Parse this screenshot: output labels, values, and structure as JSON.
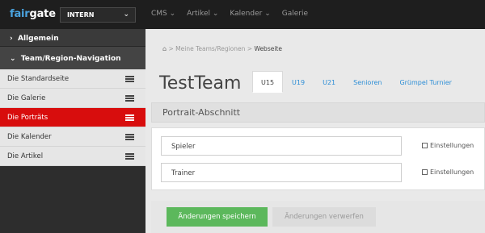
{
  "header": {
    "logo_part1": "fair",
    "logo_part2": "gate",
    "environment": "INTERN",
    "nav": [
      "CMS ⌄",
      "Artikel ⌄",
      "Kalender ⌄",
      "Galerie"
    ]
  },
  "sidebar": {
    "section1": "Allgemein",
    "section2": "Team/Region-Navigation",
    "items": [
      {
        "label": "Die Standardseite",
        "active": false
      },
      {
        "label": "Die Galerie",
        "active": false
      },
      {
        "label": "Die Porträts",
        "active": true
      },
      {
        "label": "Die Kalender",
        "active": false
      },
      {
        "label": "Die Artikel",
        "active": false
      }
    ]
  },
  "breadcrumb": {
    "home_icon": "home-icon",
    "middle": "Meine Teams/Regionen",
    "current": "Webseite",
    "separator": ">"
  },
  "main": {
    "title": "TestTeam",
    "tabs": [
      "U15",
      "U19",
      "U21",
      "Senioren",
      "Grümpel Turnier"
    ],
    "active_tab": "U15",
    "section_title": "Portrait-Abschnitt",
    "rows": [
      {
        "name": "Spieler",
        "settings": "Einstellungen"
      },
      {
        "name": "Trainer",
        "settings": "Einstellungen"
      }
    ],
    "save_button": "Änderungen speichern",
    "discard_button": "Änderungen verwerfen"
  },
  "colors": {
    "accent_red": "#d80d0d",
    "save_green": "#5cb85c",
    "link_blue": "#2d8ed6",
    "topbar": "#1e1e1e"
  }
}
